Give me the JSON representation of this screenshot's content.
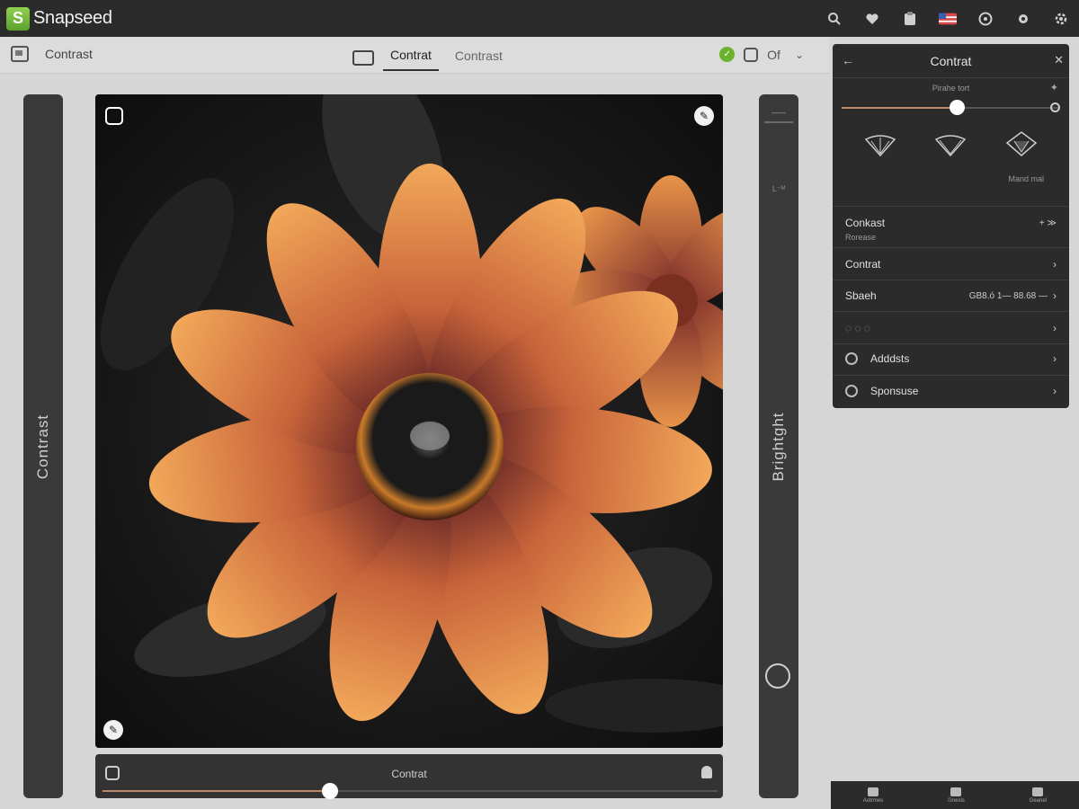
{
  "app": {
    "title": "Snapseed",
    "logo_letter": "S"
  },
  "titlebar_icons": [
    "search-icon",
    "heart-icon",
    "clipboard-icon",
    "flag-icon",
    "compass-icon",
    "settings-icon",
    "gear-icon"
  ],
  "toolbar": {
    "left_label": "Contrast",
    "tabs": [
      {
        "label": "Contrat",
        "active": true
      },
      {
        "label": "Contrast",
        "active": false
      }
    ],
    "right_label": "Of"
  },
  "left_slider": {
    "label": "Contrast"
  },
  "right_slider": {
    "label": "Brightght",
    "top_label": "——",
    "mid_label": "L⁻ᴹ"
  },
  "bottom_slider": {
    "label": "Contrat",
    "value": 0.37
  },
  "panel": {
    "title": "Contrat",
    "subtitle": "Pirahe tort",
    "slider_value": 0.53,
    "preset_caption": "Mand mal",
    "rows": [
      {
        "label": "Conkast",
        "sub": "Rorease",
        "right": "+ ≫"
      },
      {
        "label": "Contrat",
        "right": ""
      },
      {
        "label": "Sbaeh",
        "right": "GB8.ó 1— 88.68 —"
      },
      {
        "label": "◌ ◌ ◌",
        "right": ""
      },
      {
        "label": "Adddsts",
        "right": ""
      },
      {
        "label": "Sponsuse",
        "right": ""
      }
    ]
  },
  "mini_bar": [
    {
      "label": "Aotrmes"
    },
    {
      "label": "Gnesls"
    },
    {
      "label": "Geanel"
    }
  ]
}
